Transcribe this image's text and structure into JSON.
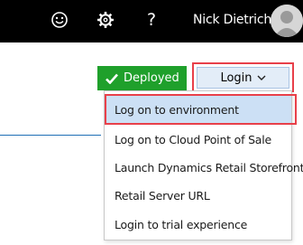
{
  "header": {
    "user_name": "Nick Dietrich",
    "help_label": "?",
    "icons": [
      "smiley-icon",
      "gear-icon",
      "help-icon",
      "avatar"
    ]
  },
  "status": {
    "deployed_label": "Deployed",
    "deployed_color": "#1fa02b"
  },
  "login": {
    "label": "Login",
    "highlight_color": "#e8404a"
  },
  "menu": {
    "items": [
      {
        "label": "Log on to environment",
        "selected": true
      },
      {
        "label": "Log on to Cloud Point of Sale",
        "selected": false
      },
      {
        "label": "Launch Dynamics Retail Storefront",
        "selected": false
      },
      {
        "label": "Retail Server URL",
        "selected": false
      },
      {
        "label": "Login to trial experience",
        "selected": false
      }
    ]
  }
}
